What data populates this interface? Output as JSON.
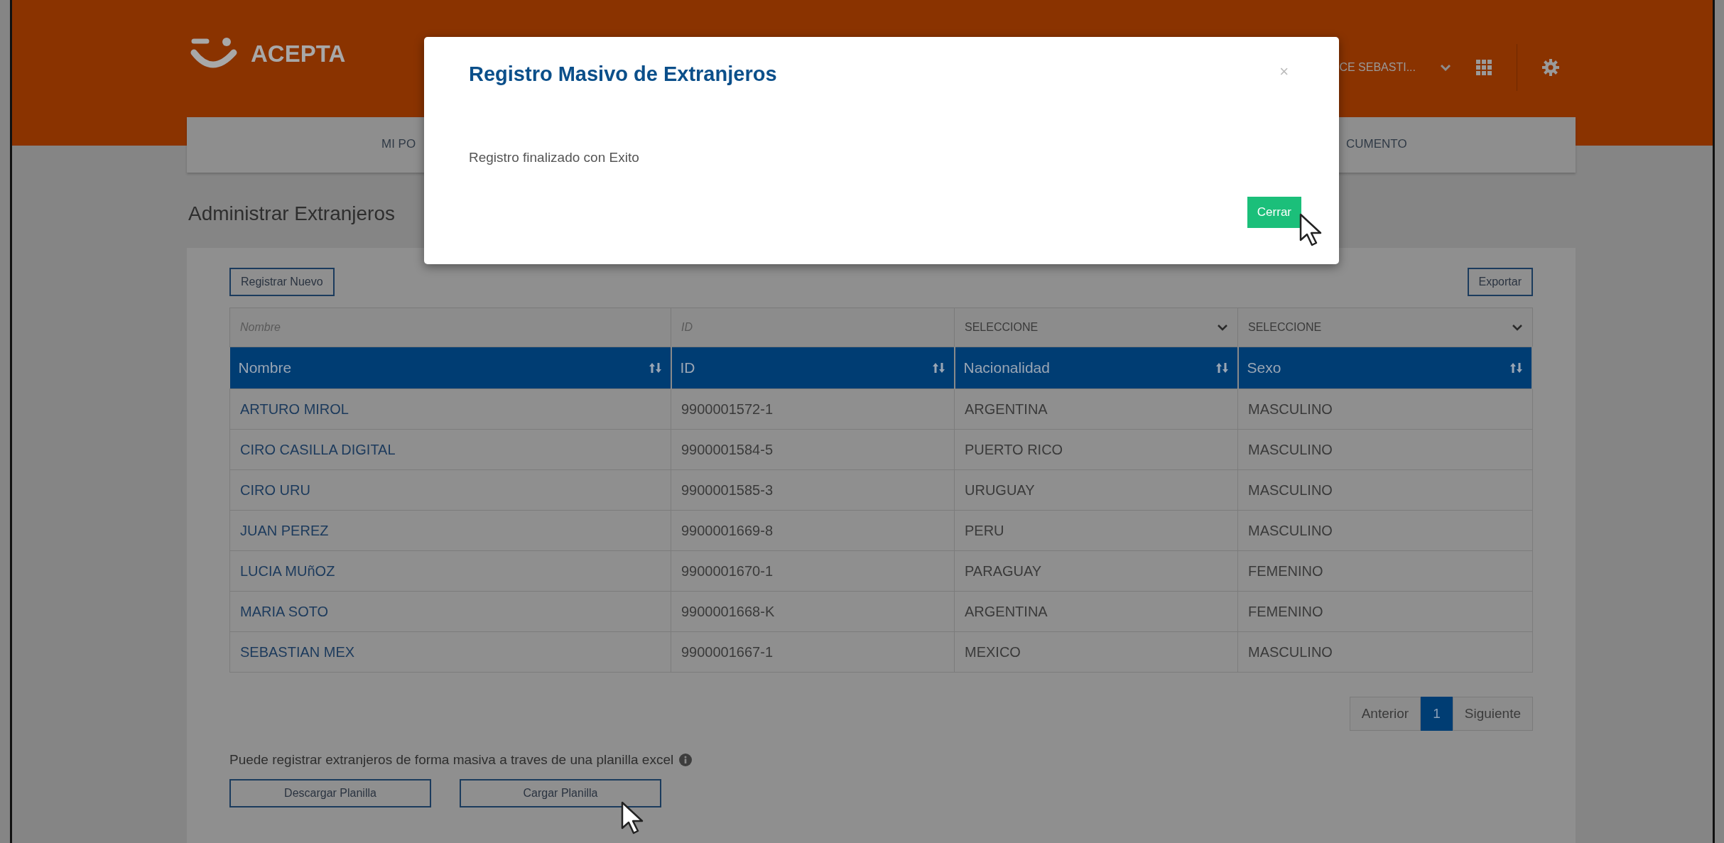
{
  "header": {
    "logo_text": "ACEPTA",
    "user": "CE SEBASTI...",
    "nav_items": [
      "MI PO",
      "CUMENTO"
    ]
  },
  "page_title": "Administrar Extranjeros",
  "toolbar": {
    "new_button": "Registrar Nuevo",
    "export_button": "Exportar"
  },
  "filters": [
    {
      "kind": "text",
      "placeholder": "Nombre"
    },
    {
      "kind": "text",
      "placeholder": "ID"
    },
    {
      "kind": "select",
      "value": "SELECCIONE"
    },
    {
      "kind": "select",
      "value": "SELECCIONE"
    }
  ],
  "table": {
    "columns": [
      "Nombre",
      "ID",
      "Nacionalidad",
      "Sexo"
    ],
    "rows": [
      [
        "ARTURO MIROL",
        "9900001572-1",
        "ARGENTINA",
        "MASCULINO"
      ],
      [
        "CIRO CASILLA DIGITAL",
        "9900001584-5",
        "PUERTO RICO",
        "MASCULINO"
      ],
      [
        "CIRO URU",
        "9900001585-3",
        "URUGUAY",
        "MASCULINO"
      ],
      [
        "JUAN PEREZ",
        "9900001669-8",
        "PERU",
        "MASCULINO"
      ],
      [
        "LUCIA MUñOZ",
        "9900001670-1",
        "PARAGUAY",
        "FEMENINO"
      ],
      [
        "MARIA SOTO",
        "9900001668-K",
        "ARGENTINA",
        "FEMENINO"
      ],
      [
        "SEBASTIAN MEX",
        "9900001667-1",
        "MEXICO",
        "MASCULINO"
      ]
    ]
  },
  "pagination": {
    "previous": "Anterior",
    "pages": [
      {
        "label": "1",
        "selected": true
      }
    ],
    "next": "Siguiente"
  },
  "bulk": {
    "info": "Puede registrar extranjeros de forma masiva a traves de una planilla excel",
    "download_button": "Descargar Planilla",
    "upload_button": "Cargar Planilla"
  },
  "modal": {
    "title": "Registro Masivo de Extranjeros",
    "close": "×",
    "message": "Registro finalizado con Exito",
    "button": "Cerrar"
  }
}
